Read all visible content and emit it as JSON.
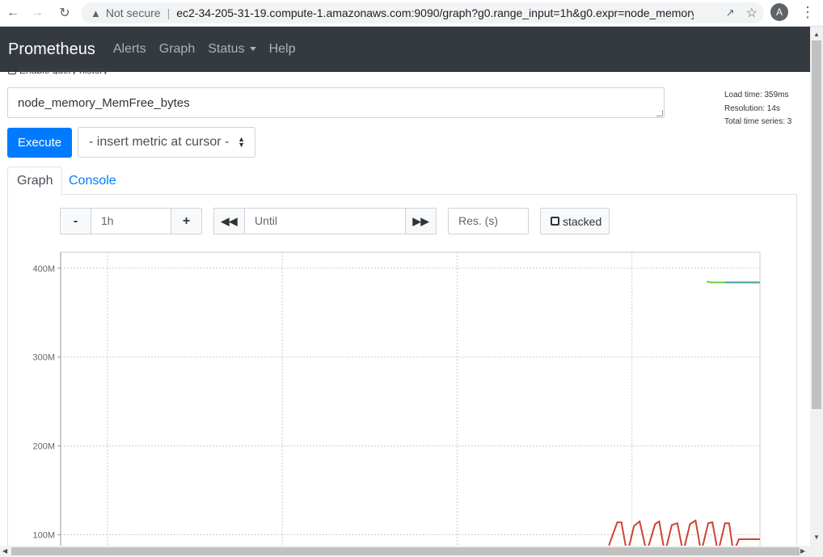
{
  "browser": {
    "security_label": "Not secure",
    "url": "ec2-34-205-31-19.compute-1.amazonaws.com:9090/graph?g0.range_input=1h&g0.expr=node_memory...",
    "avatar_letter": "A"
  },
  "navbar": {
    "brand": "Prometheus",
    "links": [
      "Alerts",
      "Graph",
      "Status",
      "Help"
    ]
  },
  "query": {
    "history_label": "Enable query history",
    "expression": "node_memory_MemFree_bytes",
    "execute_label": "Execute",
    "metric_select": "- insert metric at cursor -"
  },
  "stats": {
    "load_time": "Load time: 359ms",
    "resolution": "Resolution: 14s",
    "total_series": "Total time series: 3"
  },
  "tabs": [
    "Graph",
    "Console"
  ],
  "graph_controls": {
    "minus": "-",
    "range": "1h",
    "plus": "+",
    "until_placeholder": "Until",
    "res_placeholder": "Res. (s)",
    "stacked_label": "stacked"
  },
  "colors": {
    "navbar_bg": "#343a40",
    "primary": "#007bff",
    "series_green": "#6ecf3f",
    "series_teal": "#4aa5a0",
    "series_red": "#cc4433"
  },
  "chart_data": {
    "type": "line",
    "yticks": [
      "400M",
      "300M",
      "200M",
      "100M"
    ],
    "ytick_values": [
      400000000,
      300000000,
      200000000,
      100000000
    ],
    "ylim": [
      75000000,
      418000000
    ],
    "xlim": [
      0,
      1
    ],
    "grid": true,
    "series": [
      {
        "color": "#6ecf3f",
        "points": [
          [
            0.924,
            385000000
          ],
          [
            0.93,
            384000000
          ],
          [
            1.0,
            384000000
          ]
        ]
      },
      {
        "color": "#4aa5a0",
        "points": [
          [
            0.95,
            384000000
          ],
          [
            1.0,
            384000000
          ]
        ]
      },
      {
        "color": "#cc4433",
        "points": [
          [
            0.784,
            88000000
          ],
          [
            0.796,
            114000000
          ],
          [
            0.802,
            114000000
          ],
          [
            0.81,
            78000000
          ],
          [
            0.82,
            110000000
          ],
          [
            0.828,
            115000000
          ],
          [
            0.838,
            80000000
          ],
          [
            0.85,
            112000000
          ],
          [
            0.856,
            115000000
          ],
          [
            0.864,
            79000000
          ],
          [
            0.874,
            111000000
          ],
          [
            0.882,
            113000000
          ],
          [
            0.89,
            80000000
          ],
          [
            0.9,
            112000000
          ],
          [
            0.908,
            116000000
          ],
          [
            0.916,
            80000000
          ],
          [
            0.926,
            113000000
          ],
          [
            0.932,
            114000000
          ],
          [
            0.94,
            80000000
          ],
          [
            0.95,
            113000000
          ],
          [
            0.956,
            113000000
          ],
          [
            0.962,
            80000000
          ],
          [
            0.97,
            95000000
          ],
          [
            1.0,
            95000000
          ]
        ]
      }
    ]
  }
}
